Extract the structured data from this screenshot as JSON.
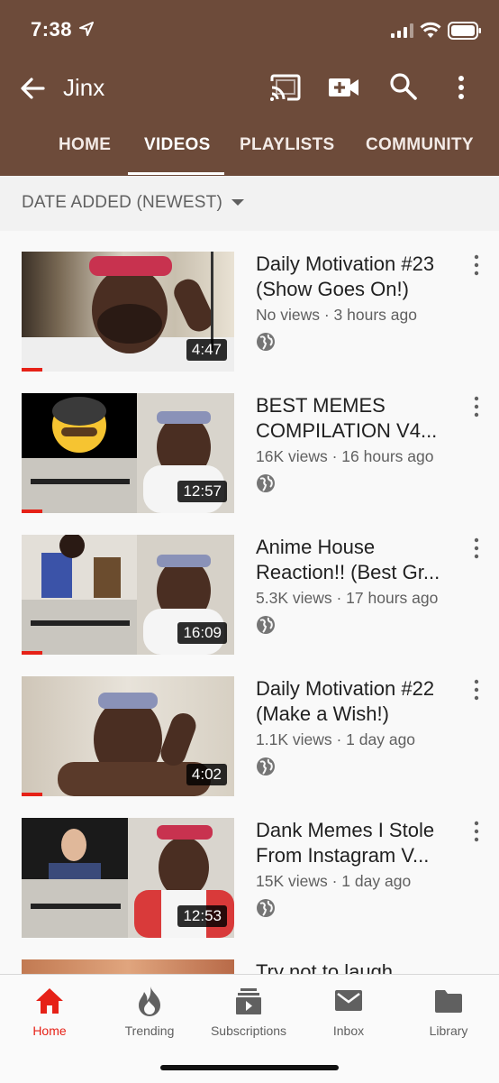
{
  "status": {
    "time": "7:38"
  },
  "appbar": {
    "title": "Jinx"
  },
  "tabs": [
    {
      "label": "HOME",
      "active": false
    },
    {
      "label": "VIDEOS",
      "active": true
    },
    {
      "label": "PLAYLISTS",
      "active": false
    },
    {
      "label": "COMMUNITY",
      "active": false
    }
  ],
  "sort": {
    "label": "DATE ADDED (NEWEST)"
  },
  "videos": [
    {
      "title_line1": "Daily Motivation #23",
      "title_line2": "(Show Goes On!)",
      "meta": "No views · 3 hours ago",
      "duration": "4:47",
      "watched_fraction": 0.1
    },
    {
      "title_line1": "BEST MEMES",
      "title_line2": "COMPILATION V4...",
      "meta": "16K views · 16 hours ago",
      "duration": "12:57",
      "watched_fraction": 0.1
    },
    {
      "title_line1": "Anime House",
      "title_line2": "Reaction!! (Best Gr...",
      "meta": "5.3K views · 17 hours ago",
      "duration": "16:09",
      "watched_fraction": 0.1
    },
    {
      "title_line1": "Daily Motivation #22",
      "title_line2": "(Make a Wish!)",
      "meta": "1.1K views · 1 day ago",
      "duration": "4:02",
      "watched_fraction": 0.1
    },
    {
      "title_line1": "Dank Memes I Stole",
      "title_line2": "From Instagram V...",
      "meta": "15K views · 1 day ago",
      "duration": "12:53",
      "watched_fraction": 0.0
    },
    {
      "title_line1": "Try not to laugh",
      "title_line2": "",
      "meta": "",
      "duration": "",
      "watched_fraction": 0.0
    }
  ],
  "bottomnav": [
    {
      "label": "Home",
      "icon": "home-icon",
      "active": true
    },
    {
      "label": "Trending",
      "icon": "trending-icon",
      "active": false
    },
    {
      "label": "Subscriptions",
      "icon": "subscriptions-icon",
      "active": false
    },
    {
      "label": "Inbox",
      "icon": "inbox-icon",
      "active": false
    },
    {
      "label": "Library",
      "icon": "library-icon",
      "active": false
    }
  ],
  "colors": {
    "header": "#6d4b3a",
    "accent": "#e62117"
  }
}
